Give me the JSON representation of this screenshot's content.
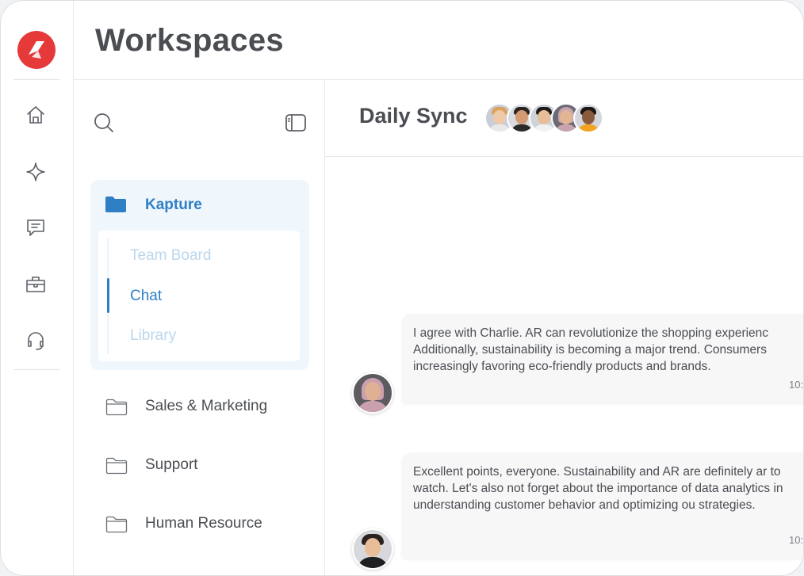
{
  "header": {
    "title": "Workspaces"
  },
  "rail": {
    "items": [
      {
        "name": "home-icon"
      },
      {
        "name": "sparkle-icon"
      },
      {
        "name": "chat-icon"
      },
      {
        "name": "briefcase-icon"
      },
      {
        "name": "headset-icon"
      }
    ],
    "brand_color": "#e63a3a"
  },
  "workspaces": {
    "active": {
      "name": "Kapture",
      "subitems": [
        {
          "label": "Team Board",
          "active": false
        },
        {
          "label": "Chat",
          "active": true
        },
        {
          "label": "Library",
          "active": false
        }
      ]
    },
    "items": [
      {
        "label": "Sales & Marketing"
      },
      {
        "label": "Support"
      },
      {
        "label": "Human Resource"
      }
    ],
    "accent_color": "#2f7fc5"
  },
  "chat": {
    "title": "Daily Sync",
    "member_count": 5,
    "messages": [
      {
        "text": "I agree with Charlie. AR can revolutionize the shopping experienc Additionally, sustainability is becoming a major trend. Consumers increasingly favoring eco-friendly products and brands.",
        "time": "10:"
      },
      {
        "text": "Excellent points, everyone. Sustainability and AR are definitely ar to watch. Let's also not forget about the importance of data analytics in understanding customer behavior and optimizing ou strategies.",
        "time": "10:"
      }
    ]
  }
}
